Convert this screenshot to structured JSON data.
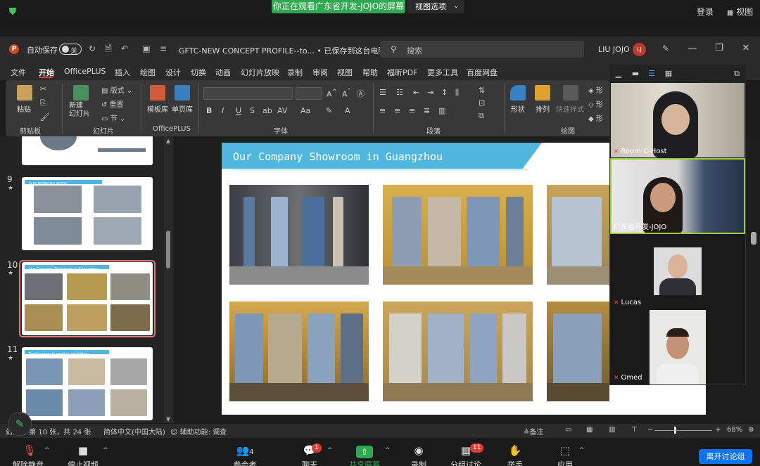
{
  "zoom": {
    "share_banner": "你正在观看广东省开发-JOJO的屏幕",
    "view_options": "视图选项",
    "login": "登录",
    "view": "视图",
    "leave_breakout": "离开讨论组",
    "controls": [
      {
        "icon": "mic-muted-icon",
        "label": "解除静音"
      },
      {
        "icon": "video-icon",
        "label": "停止视频"
      },
      {
        "icon": "participants-icon",
        "label": "参会者",
        "count": "4"
      },
      {
        "icon": "chat-icon",
        "label": "聊天",
        "badge": "1"
      },
      {
        "icon": "share-screen-icon",
        "label": "共享屏幕"
      },
      {
        "icon": "record-icon",
        "label": "录制"
      },
      {
        "icon": "breakout-rooms-icon",
        "label": "分组讨论",
        "badge": "11"
      },
      {
        "icon": "raise-hand-icon",
        "label": "举手"
      },
      {
        "icon": "apps-icon",
        "label": "应用"
      }
    ],
    "participants": [
      {
        "name": "Room C-Host",
        "muted": true
      },
      {
        "name": "广东省开发-JOJO",
        "muted": false
      },
      {
        "name": "Lucas",
        "muted": true
      },
      {
        "name": "Omed",
        "muted": true
      }
    ]
  },
  "ppt": {
    "autosave_label": "自动保存",
    "autosave_state": "关",
    "doc_title": "GFTC-NEW CONCEPT PROFILE--to... • 已保存到这台电脑 ⌄",
    "search_placeholder": "搜索",
    "user_name": "LIU JOJO",
    "user_initials": "LJ",
    "menu": [
      "文件",
      "开始",
      "OfficePLUS",
      "插入",
      "绘图",
      "设计",
      "切换",
      "动画",
      "幻灯片放映",
      "录制",
      "审阅",
      "视图",
      "帮助",
      "福昕PDF",
      "更多工具",
      "百度网盘"
    ],
    "active_menu": "开始",
    "ribbon": {
      "paste": "粘贴",
      "clipboard_group": "剪贴板",
      "new_slide": "新建\n幻灯片",
      "layout": "版式",
      "reset": "重置",
      "section": "节",
      "slides_group": "幻灯片",
      "template_lib": "模板库",
      "single_page_lib": "单页库",
      "officeplus_group": "OfficePLUS",
      "font_group": "字体",
      "paragraph_group": "段落",
      "shape": "形状",
      "arrange": "排列",
      "quick_styles": "快速样式",
      "drawing_group": "绘图",
      "shape_partial": "形"
    },
    "thumbnails": [
      {
        "number": "9",
        "title": "OUR WORKING MODE"
      },
      {
        "number": "10",
        "title": "Our Company Showroom in Guangzhou",
        "selected": true
      },
      {
        "number": "11",
        "title": "Participation in various exhibitions"
      }
    ],
    "slide_title": "Our Company Showroom in Guangzhou",
    "status": {
      "slide_info": "幻灯片 第 10 张，共 24 张",
      "language": "简体中文(中国大陆)",
      "accessibility": "辅助功能: 调查",
      "notes": "备注",
      "zoom_minus": "−",
      "zoom_plus": "+",
      "zoom_level": "68%"
    }
  },
  "colors": {
    "zoom_green": "#2fa84f",
    "ppt_accent": "#d24726",
    "slide_title_bar": "#4fb7dd",
    "leave_button": "#0e72ed"
  }
}
